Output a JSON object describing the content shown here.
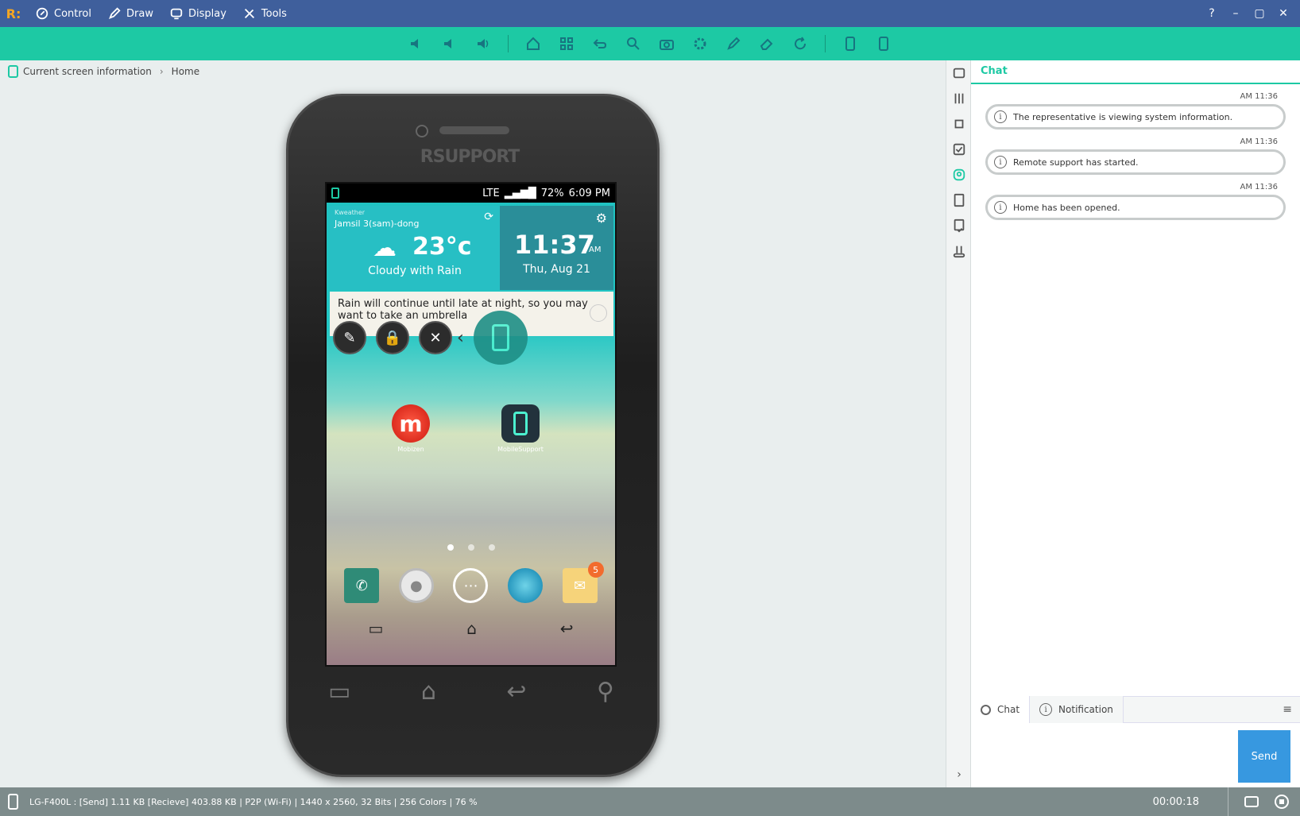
{
  "menu": {
    "items": [
      "Control",
      "Draw",
      "Display",
      "Tools"
    ],
    "window_controls": [
      "?",
      "–",
      "▢",
      "✕"
    ]
  },
  "toolbar": {
    "icons": [
      "mute-icon",
      "volume-down-icon",
      "volume-up-icon",
      "home-icon",
      "apps-icon",
      "back-icon",
      "search-icon",
      "camera-icon",
      "settings-icon",
      "pen-icon",
      "eraser-icon",
      "refresh-icon",
      "portrait-icon",
      "landscape-icon"
    ]
  },
  "breadcrumb": {
    "current": "Current screen information",
    "page": "Home"
  },
  "device": {
    "brand": "RSUPPORT",
    "statusbar": {
      "network": "LTE",
      "battery": "72%",
      "time": "6:09 PM"
    },
    "weather": {
      "source": "Kweather",
      "location": "Jamsil 3(sam)-dong",
      "temp": "23°c",
      "condition": "Cloudy with Rain",
      "forecast": "Rain will continue until late at night, so you may want to take an umbrella"
    },
    "clock": {
      "time": "11:37",
      "ampm": "AM",
      "date": "Thu, Aug 21"
    },
    "apps": [
      {
        "name": "Mobizen"
      },
      {
        "name": "MobileSupport"
      }
    ],
    "email_badge": "5"
  },
  "chat": {
    "title": "Chat",
    "messages": [
      {
        "time": "AM 11:36",
        "text": "The representative is viewing system information."
      },
      {
        "time": "AM 11:36",
        "text": "Remote support has started."
      },
      {
        "time": "AM 11:36",
        "text": "Home has been opened."
      }
    ],
    "tabs": {
      "chat": "Chat",
      "notification": "Notification"
    },
    "send": "Send"
  },
  "status": {
    "info": "LG-F400L : [Send] 1.11 KB  [Recieve] 403.88 KB | P2P (Wi-Fi) | 1440 x 2560, 32 Bits | 256 Colors | 76 %",
    "timer": "00:00:18"
  },
  "colors": {
    "accent": "#1dc9a4",
    "titlebar": "#3f5f9c",
    "send": "#3798e0"
  }
}
